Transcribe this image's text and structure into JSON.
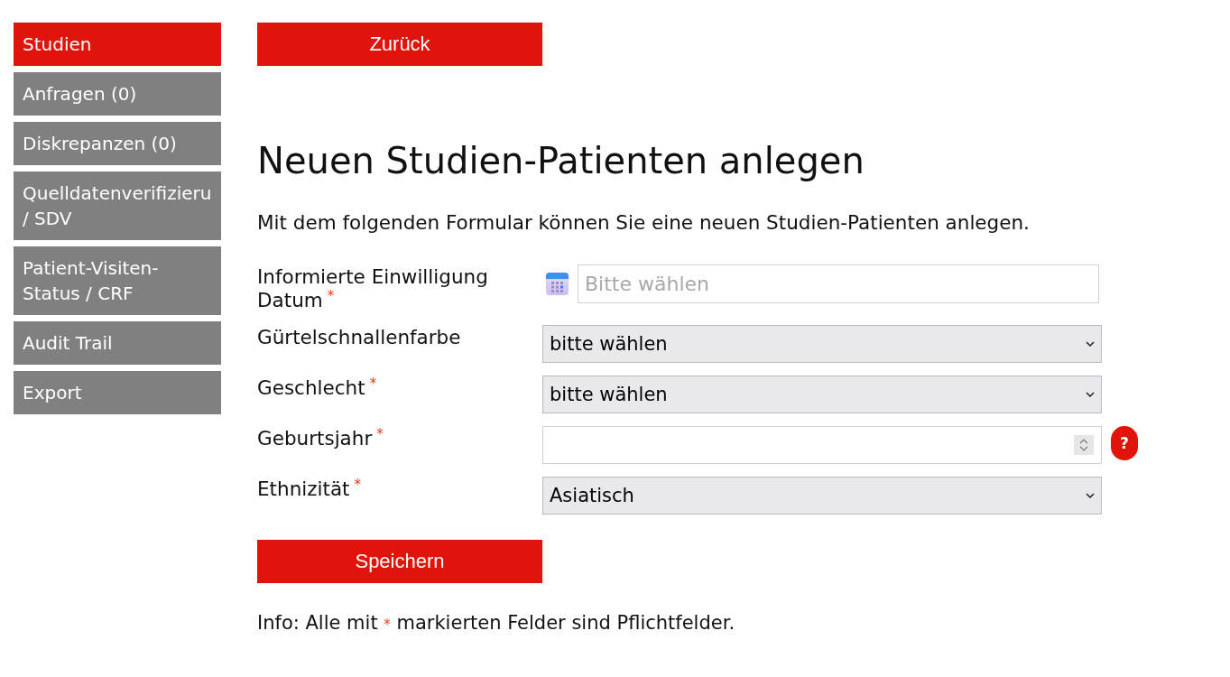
{
  "sidebar": {
    "items": [
      {
        "label": "Studien",
        "selected": true
      },
      {
        "label": "Anfragen (0)",
        "selected": false
      },
      {
        "label": "Diskrepanzen (0)",
        "selected": false
      },
      {
        "label": "Quelldatenverifizieru / SDV",
        "selected": false
      },
      {
        "label": "Patient-Visiten-Status / CRF",
        "selected": false
      },
      {
        "label": "Audit Trail",
        "selected": false
      },
      {
        "label": "Export",
        "selected": false
      }
    ]
  },
  "back_button": "Zurück",
  "title": "Neuen Studien-Patienten anlegen",
  "intro": "Mit dem folgenden Formular können Sie eine neuen Studien-Patienten anlegen.",
  "form": {
    "required_mark": "*",
    "fields": [
      {
        "label": "Informierte Einwilligung Datum",
        "required": true,
        "kind": "date",
        "placeholder": "Bitte wählen"
      },
      {
        "label": "Gürtelschnallenfarbe",
        "required": false,
        "kind": "select",
        "value": "bitte wählen"
      },
      {
        "label": "Geschlecht",
        "required": true,
        "kind": "select",
        "value": "bitte wählen"
      },
      {
        "label": "Geburtsjahr",
        "required": true,
        "kind": "number",
        "help": "?"
      },
      {
        "label": "Ethnizität",
        "required": true,
        "kind": "select",
        "value": "Asiatisch"
      }
    ]
  },
  "save_button": "Speichern",
  "info_note": {
    "lead": "Info: Alle mit",
    "mark": "*",
    "rest": "markierten Felder sind Pflichtfelder."
  }
}
